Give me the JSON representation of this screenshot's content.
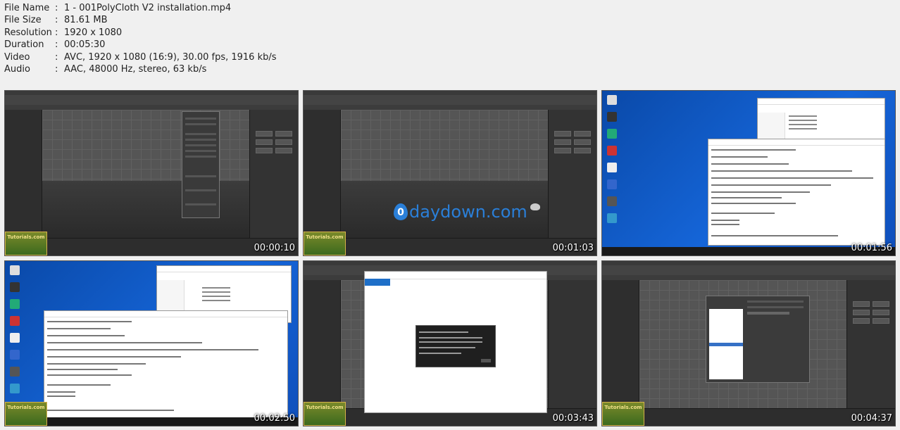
{
  "info": [
    {
      "key": "File Name",
      "value": "1 - 001PolyCloth V2 installation.mp4"
    },
    {
      "key": "File Size",
      "value": "81.61 MB"
    },
    {
      "key": "Resolution",
      "value": "1920 x 1080"
    },
    {
      "key": "Duration",
      "value": "00:05:30"
    },
    {
      "key": "Video",
      "value": "AVC, 1920 x 1080 (16:9), 30.00 fps, 1916 kb/s"
    },
    {
      "key": "Audio",
      "value": "AAC, 48000 Hz, stereo, 63 kb/s"
    }
  ],
  "separator": ":",
  "watermark": "daydown.com",
  "watermark_initial": "0",
  "badge_text": "Tutorials.com",
  "thumbnails": [
    {
      "timestamp": "00:00:10"
    },
    {
      "timestamp": "00:01:03"
    },
    {
      "timestamp": "00:01:56"
    },
    {
      "timestamp": "00:02:50"
    },
    {
      "timestamp": "00:03:43"
    },
    {
      "timestamp": "00:04:37"
    }
  ]
}
